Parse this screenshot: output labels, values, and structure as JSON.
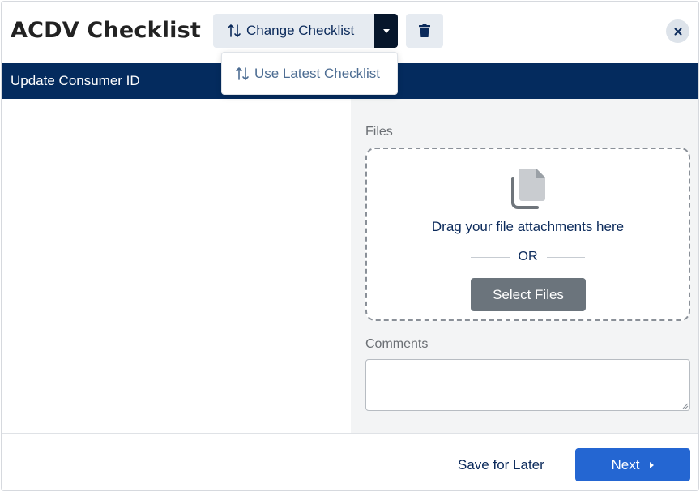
{
  "header": {
    "title": "ACDV Checklist",
    "change_checklist_label": "Change Checklist"
  },
  "dropdown": {
    "items": [
      {
        "label": "Use Latest Checklist",
        "icon": "swap-arrows-icon"
      }
    ]
  },
  "banner": {
    "label": "Update Consumer ID"
  },
  "files": {
    "label": "Files",
    "drop_text": "Drag your file attachments here",
    "or_text": "OR",
    "select_label": "Select Files"
  },
  "comments": {
    "label": "Comments",
    "value": "",
    "placeholder": ""
  },
  "footer": {
    "save_later_label": "Save for Later",
    "next_label": "Next"
  },
  "colors": {
    "banner_bg": "#042b5e",
    "primary": "#2466d2",
    "split_dark": "#06162b",
    "muted_button": "#6b747c"
  }
}
